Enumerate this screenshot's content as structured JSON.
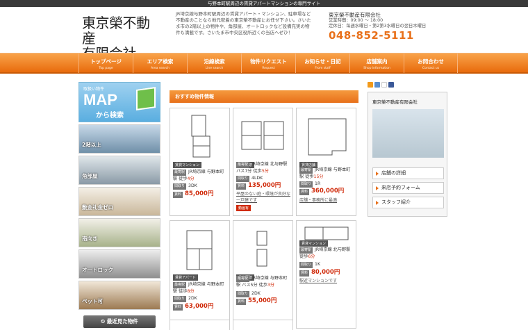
{
  "topbar": "与野本町駅周辺の賃貸アパートマンションの専門サイト",
  "header": {
    "logo_line1": "東京榮不動産",
    "logo_line2": "有限会社",
    "intro": "JR埼京線与野本町駅周辺の賃貸アパート・マンション、駐車場など不動産のことなら地元密着の東京榮不動産にお任せ下さい。さいたま市の2階以上の物件や、角部屋、オートロックなど設備充実の物件も満載です。さいたま市中央区役所近くの当店へぜひ！",
    "company": "東京榮不動産有限会社",
    "hours": "営業時間：09:00 ～ 18:00",
    "closed": "定休日：毎週水曜日・第2第3水曜日の翌日木曜日",
    "phone": "048-852-5111"
  },
  "nav": [
    {
      "jp": "トップページ",
      "en": "Top page"
    },
    {
      "jp": "エリア検索",
      "en": "Area search"
    },
    {
      "jp": "沿線検索",
      "en": "Line search"
    },
    {
      "jp": "物件リクエスト",
      "en": "Request"
    },
    {
      "jp": "お知らせ・日記",
      "en": "From staff"
    },
    {
      "jp": "店舗案内",
      "en": "Shop information"
    },
    {
      "jp": "お問合わせ",
      "en": "Contact us"
    }
  ],
  "left": {
    "map_small": "取扱い物件",
    "map_big": "MAP",
    "map_sub": "から検索",
    "categories": [
      "2階以上",
      "角部屋",
      "敷金礼金ゼロ",
      "南向き",
      "オートロック",
      "ペット可"
    ],
    "recent": "最近見た物件"
  },
  "main": {
    "heading": "おすすめ物件情報",
    "labels": {
      "station": "最寄駅",
      "layout": "間取り",
      "rent": "賃料"
    },
    "cards": [
      {
        "type": "賃貸マンション",
        "station": "JR埼京線 与野本町駅 徒歩",
        "walk": "4分",
        "layout": "3DK",
        "rent": "85,000円",
        "note": "",
        "tag": ""
      },
      {
        "type": "賃貸戸建",
        "station": "JR埼京線 北与野駅 バス7分 徒歩",
        "walk": "5分",
        "layout": "4LDK",
        "rent": "135,000円",
        "note": "平屋のない庭・環境が良好な一戸建です",
        "tag": "動画有"
      },
      {
        "type": "賃貸店舗",
        "station": "JR埼京線 与野本町駅 徒歩",
        "walk": "15分",
        "layout": "1R",
        "rent": "360,000円",
        "note": "店舗・事務所に最適",
        "tag": ""
      },
      {
        "type": "賃貸アパート",
        "station": "JR埼京線 与野本町駅 徒歩",
        "walk": "8分",
        "layout": "2DK",
        "rent": "63,000円",
        "note": "",
        "tag": ""
      },
      {
        "type": "賃貸戸建",
        "station": "JR埼京線 与野本町駅 バス5分 徒歩",
        "walk": "3分",
        "layout": "2DK",
        "rent": "55,000円",
        "note": "",
        "tag": ""
      },
      {
        "type": "賃貸マンション",
        "station": "JR埼京線 北与野駅 徒歩",
        "walk": "6分",
        "layout": "1K",
        "rent": "80,000円",
        "note": "駅近マンションです",
        "tag": ""
      }
    ]
  },
  "right": {
    "title": "東京榮不動産有限会社",
    "buttons": [
      "店舗の詳細",
      "来店予約フォーム",
      "スタッフ紹介"
    ]
  },
  "colors": {
    "accent": "#e8701a",
    "price": "#d02a0a"
  }
}
